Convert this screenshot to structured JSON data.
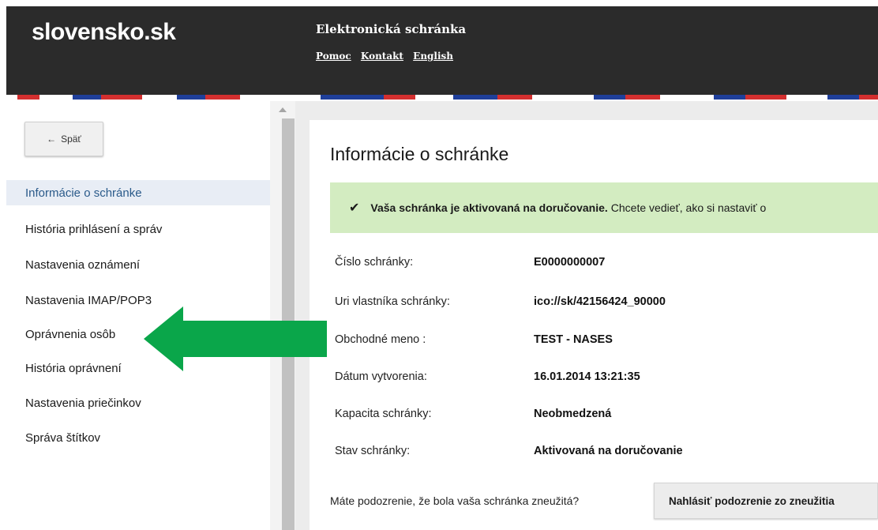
{
  "header": {
    "logo": "slovensko.sk",
    "app_title": "Elektronická schránka",
    "links": [
      "Pomoc",
      "Kontakt",
      "English"
    ]
  },
  "sidebar": {
    "back_label": "Späť",
    "items": [
      {
        "label": "Informácie o schránke",
        "active": true
      },
      {
        "label": "História prihlásení a správ"
      },
      {
        "label": "Nastavenia oznámení"
      },
      {
        "label": "Nastavenia IMAP/POP3"
      },
      {
        "label": "Oprávnenia osôb"
      },
      {
        "label": "História oprávnení"
      },
      {
        "label": "Nastavenia priečinkov"
      },
      {
        "label": "Správa štítkov"
      }
    ]
  },
  "main": {
    "title": "Informácie o schránke",
    "alert": {
      "bold_text": "Vaša schránka je aktivovaná na doručovanie.",
      "text": "Chcete vedieť, ako si nastaviť o"
    },
    "info": [
      {
        "label": "Číslo schránky:",
        "value": "E0000000007"
      },
      {
        "label": "Uri vlastníka schránky:",
        "value": "ico://sk/42156424_90000"
      },
      {
        "label": "Obchodné meno :",
        "value": "TEST - NASES"
      },
      {
        "label": "Dátum vytvorenia:",
        "value": "16.01.2014 13:21:35"
      },
      {
        "label": "Kapacita schránky:",
        "value": "Neobmedzená"
      },
      {
        "label": "Stav schránky:",
        "value": "Aktivovaná na doručovanie"
      }
    ],
    "abuse_question": "Máte podozrenie, že bola vaša schránka zneužitá?",
    "abuse_button": "Nahlásiť podozrenie zo zneužitia"
  },
  "colors": {
    "header_bg": "#2b2b2b",
    "stripe_blue": "#1f3f9a",
    "stripe_red": "#d32f2f",
    "active_nav_bg": "#e8edf5",
    "alert_bg": "#d3ecc1",
    "annotation_arrow": "#0aa64a"
  }
}
